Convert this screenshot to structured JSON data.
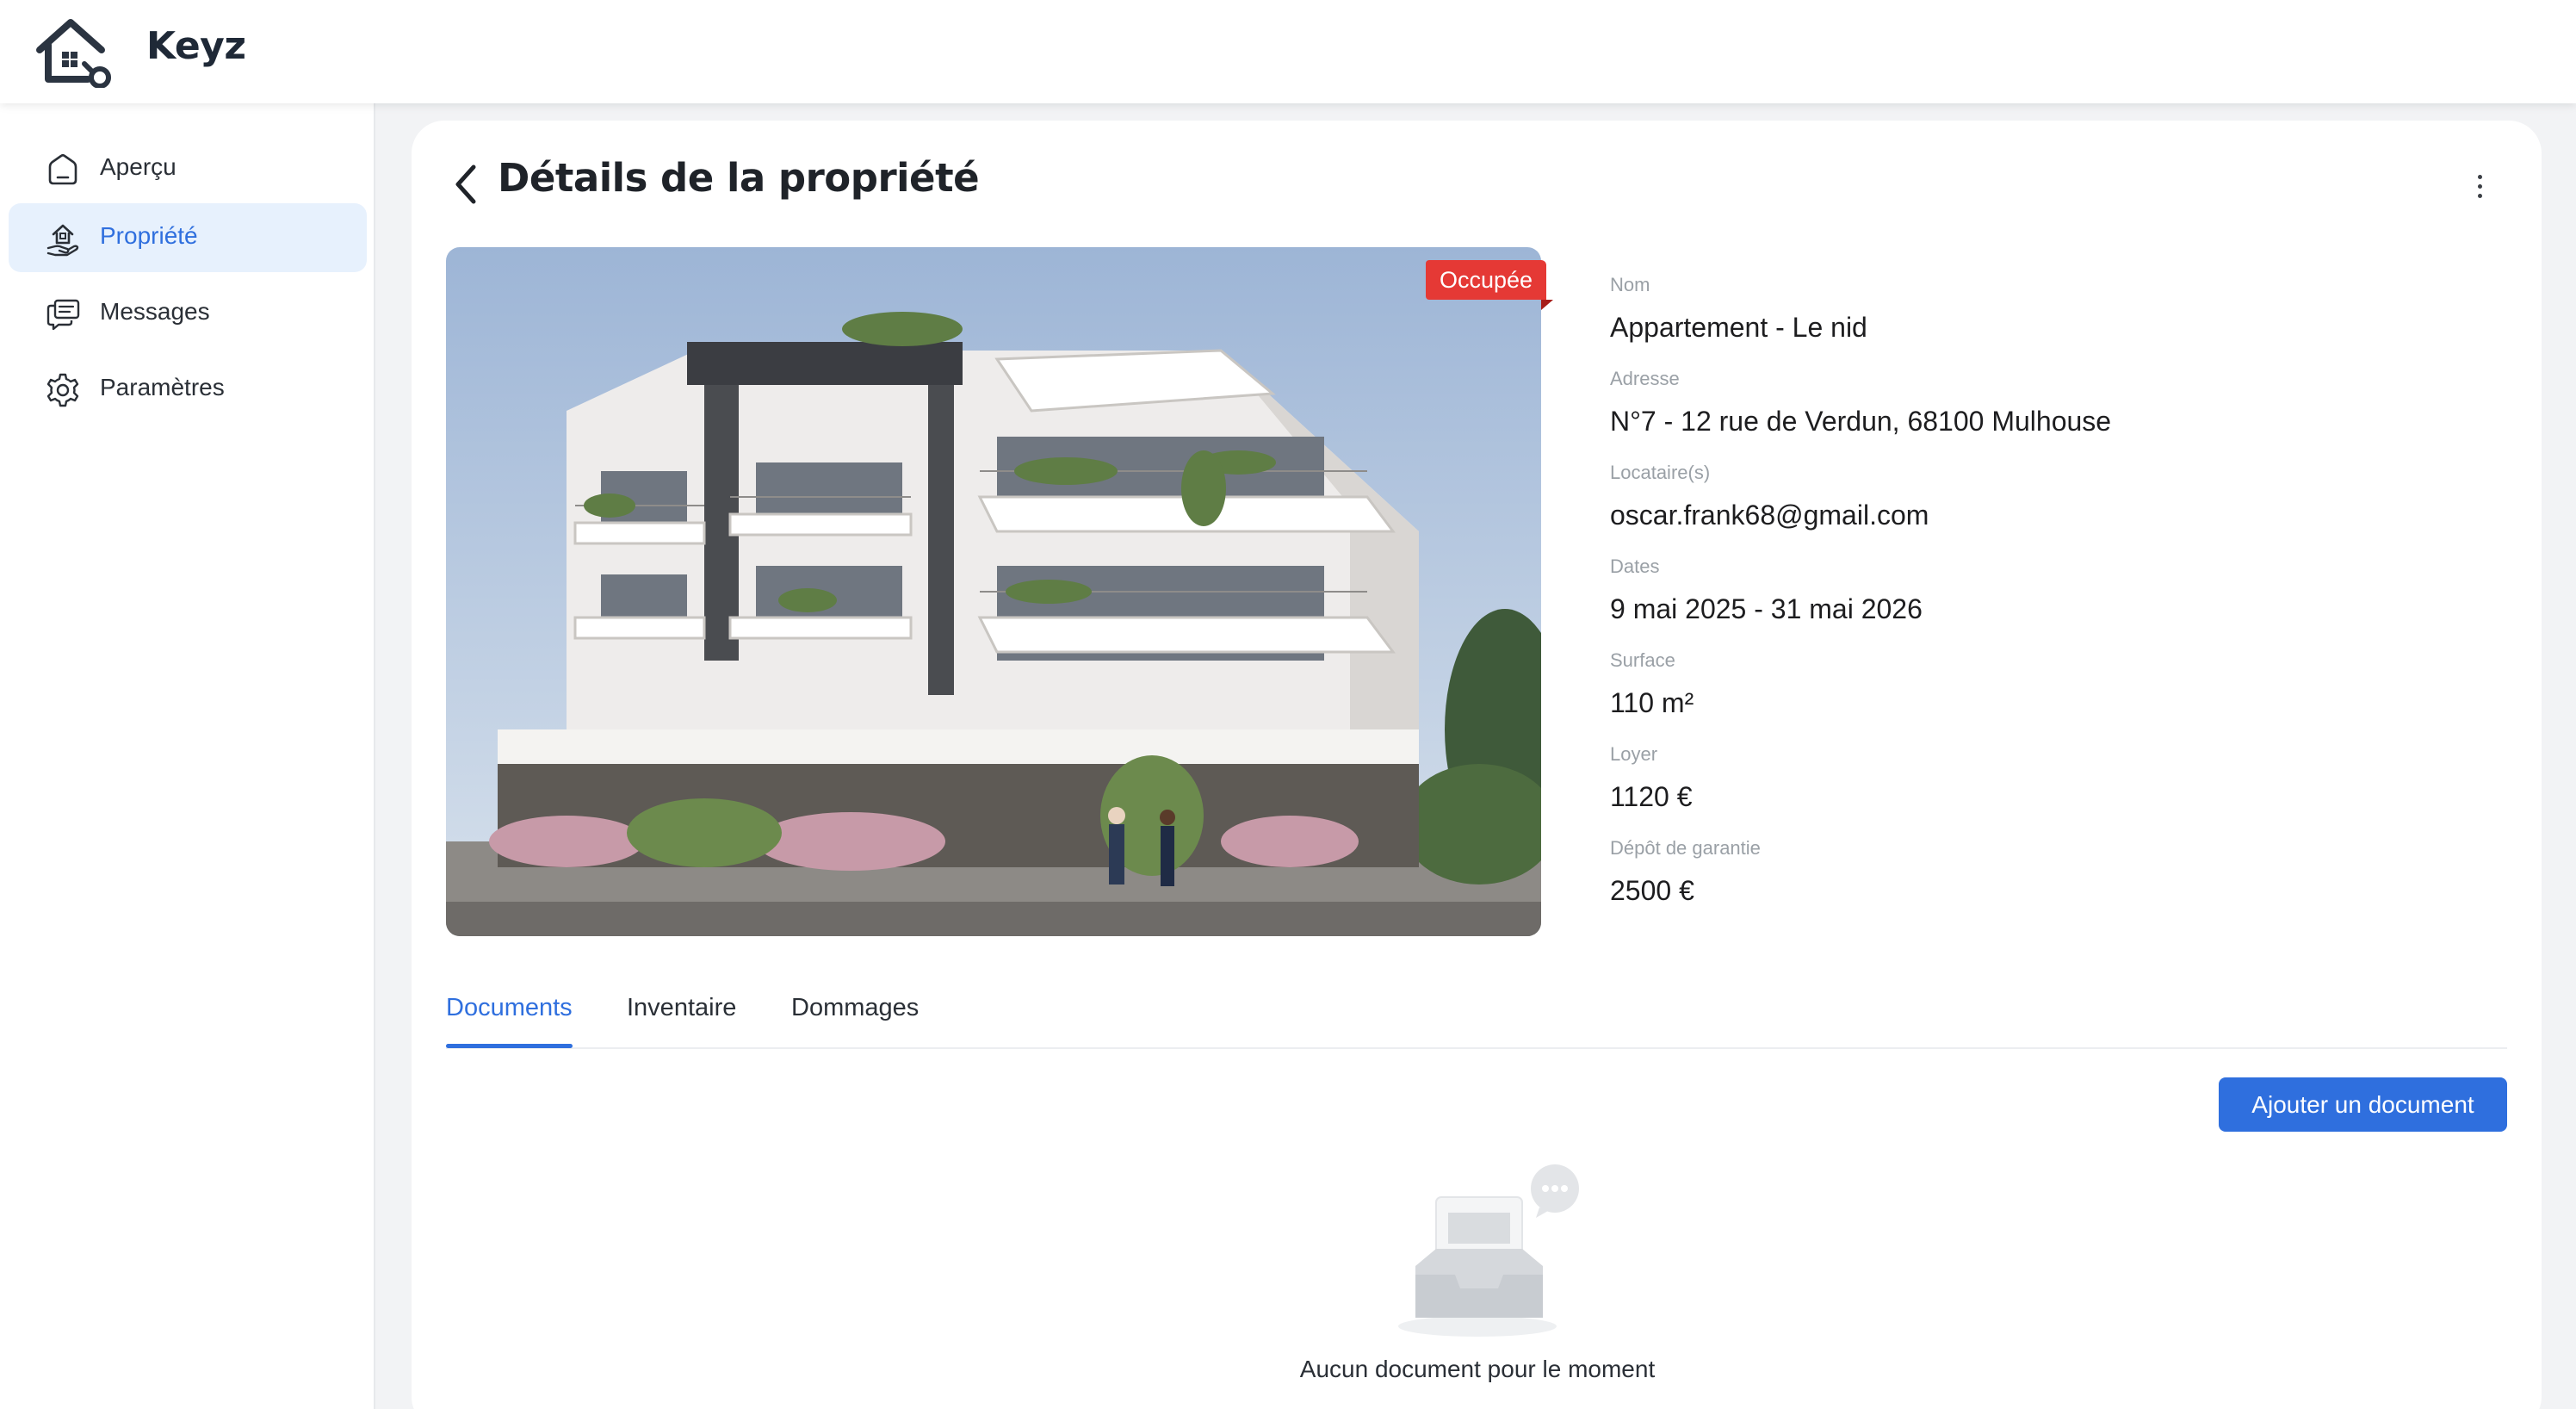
{
  "app": {
    "name": "Keyz",
    "accent_color": "#2f6fde",
    "logo_icon": "house-key-icon"
  },
  "sidebar": {
    "items": [
      {
        "label": "Aperçu",
        "icon": "home-icon",
        "active": false
      },
      {
        "label": "Propriété",
        "icon": "property-key-icon",
        "active": true
      },
      {
        "label": "Messages",
        "icon": "chat-icon",
        "active": false
      },
      {
        "label": "Paramètres",
        "icon": "gear-icon",
        "active": false
      }
    ]
  },
  "header": {
    "title": "Détails de la propriété",
    "back_icon": "chevron-left-icon",
    "more_icon": "more-vertical-icon"
  },
  "property": {
    "status": "Occupée",
    "status_color": "#e53935",
    "fields": [
      {
        "label": "Nom",
        "value": "Appartement - Le nid"
      },
      {
        "label": "Adresse",
        "value": "N°7 - 12 rue de Verdun, 68100 Mulhouse"
      },
      {
        "label": "Locataire(s)",
        "value": "oscar.frank68@gmail.com"
      },
      {
        "label": "Dates",
        "value": "9 mai 2025 - 31 mai 2026"
      },
      {
        "label": "Surface",
        "value": "110 m²"
      },
      {
        "label": "Loyer",
        "value": "1120 €"
      },
      {
        "label": "Dépôt de garantie",
        "value": "2500 €"
      }
    ]
  },
  "tabs": [
    {
      "label": "Documents",
      "active": true
    },
    {
      "label": "Inventaire",
      "active": false
    },
    {
      "label": "Dommages",
      "active": false
    }
  ],
  "documents": {
    "add_button": "Ajouter un document",
    "empty_text": "Aucun document pour le moment",
    "empty_icon": "empty-inbox-icon"
  }
}
